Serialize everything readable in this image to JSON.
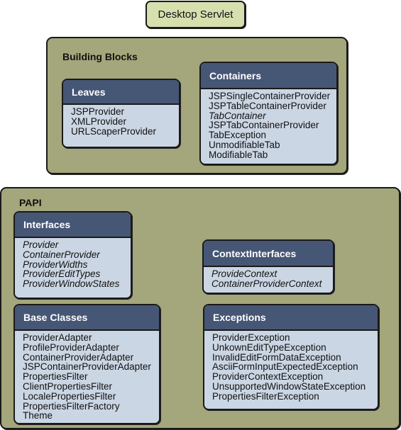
{
  "top_node": {
    "label": "Desktop Servlet"
  },
  "building_blocks": {
    "title": "Building Blocks",
    "leaves": {
      "title": "Leaves",
      "items": [
        {
          "label": "JSPProvider",
          "italic": false
        },
        {
          "label": "XMLProvider",
          "italic": false
        },
        {
          "label": "URLScaperProvider",
          "italic": false
        }
      ]
    },
    "containers": {
      "title": "Containers",
      "items": [
        {
          "label": "JSPSingleContainerProvider",
          "italic": false
        },
        {
          "label": "JSPTableContainerProvider",
          "italic": false
        },
        {
          "label": "TabContainer",
          "italic": true
        },
        {
          "label": "JSPTabContainerProvider",
          "italic": false
        },
        {
          "label": "TabException",
          "italic": false
        },
        {
          "label": "UnmodifiableTab",
          "italic": false
        },
        {
          "label": "ModifiableTab",
          "italic": false
        }
      ]
    }
  },
  "papi": {
    "title": "PAPI",
    "interfaces": {
      "title": "Interfaces",
      "items": [
        {
          "label": "Provider",
          "italic": true
        },
        {
          "label": "ContainerProvider",
          "italic": true
        },
        {
          "label": "ProviderWidths",
          "italic": true
        },
        {
          "label": "ProviderEditTypes",
          "italic": true
        },
        {
          "label": "ProviderWindowStates",
          "italic": true
        }
      ]
    },
    "context_interfaces": {
      "title": "ContextInterfaces",
      "items": [
        {
          "label": "ProvideContext",
          "italic": true
        },
        {
          "label": "ContainerProviderContext",
          "italic": true
        }
      ]
    },
    "base_classes": {
      "title": "Base Classes",
      "items": [
        {
          "label": "ProviderAdapter",
          "italic": false
        },
        {
          "label": "ProfileProviderAdapter",
          "italic": false
        },
        {
          "label": "ContainerProviderAdapter",
          "italic": false
        },
        {
          "label": "JSPContainerProviderAdapter",
          "italic": false
        },
        {
          "label": "PropertiesFilter",
          "italic": false
        },
        {
          "label": "ClientPropertiesFilter",
          "italic": false
        },
        {
          "label": "LocalePropertiesFilter",
          "italic": false
        },
        {
          "label": "PropertiesFilterFactory",
          "italic": false
        },
        {
          "label": "Theme",
          "italic": false
        }
      ]
    },
    "exceptions": {
      "title": "Exceptions",
      "items": [
        {
          "label": "ProviderException",
          "italic": false
        },
        {
          "label": "UnkownEditTypeException",
          "italic": false
        },
        {
          "label": "InvalidEditFormDataException",
          "italic": false
        },
        {
          "label": "AsciiFormInputExpectedException",
          "italic": false
        },
        {
          "label": "ProviderContextException",
          "italic": false
        },
        {
          "label": "UnsupportedWindowStateException",
          "italic": false
        },
        {
          "label": "PropertiesFilterException",
          "italic": false
        }
      ]
    }
  },
  "colors": {
    "servlet_fill": "#d6dfae",
    "group_fill": "#a4a67b",
    "box_header": "#465675",
    "box_body": "#cbd6e4",
    "outline": "#1a1a1a"
  }
}
